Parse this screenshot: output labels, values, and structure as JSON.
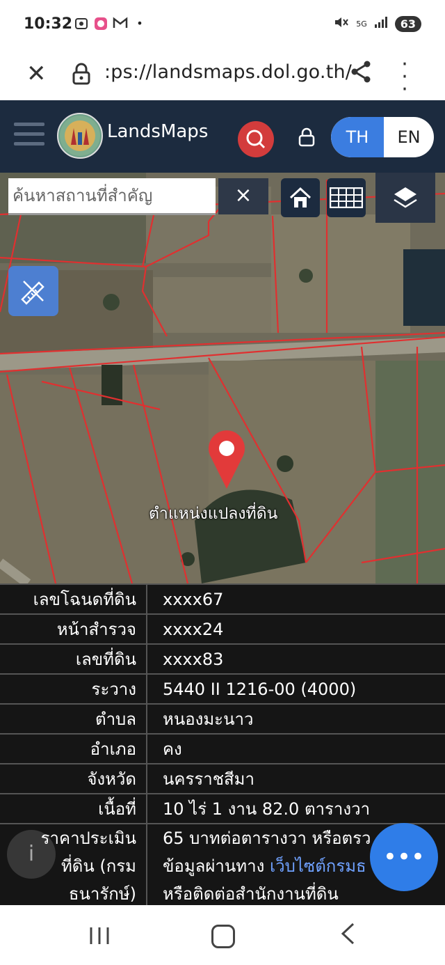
{
  "status_bar": {
    "time": "10:32",
    "network": "5G",
    "battery": "63",
    "icons": [
      "screenshot-icon",
      "app-icon",
      "gmail-icon",
      "dot-icon",
      "mute-icon",
      "signal-icon"
    ]
  },
  "browser": {
    "url": ":ps://landsmaps.dol.go.th/"
  },
  "header": {
    "title": "LandsMaps",
    "lang_th": "TH",
    "lang_en": "EN"
  },
  "map": {
    "search_placeholder": "ค้นหาสถานที่สำคัญ",
    "clear_label": "×",
    "pin_label": "ตำแหน่งแปลงที่ดิน"
  },
  "parcel": {
    "rows": [
      {
        "key": "เลขโฉนดที่ดิน",
        "value": "xxxx67"
      },
      {
        "key": "หน้าสำรวจ",
        "value": "xxxx24"
      },
      {
        "key": "เลขที่ดิน",
        "value": "xxxx83"
      },
      {
        "key": "ระวาง",
        "value": "5440 II 1216-00 (4000)"
      },
      {
        "key": "ตำบล",
        "value": "หนองมะนาว"
      },
      {
        "key": "อำเภอ",
        "value": "คง"
      },
      {
        "key": "จังหวัด",
        "value": "นครราชสีมา"
      },
      {
        "key": "เนื้อที่",
        "value": "10 ไร่ 1 งาน 82.0 ตารางวา"
      }
    ],
    "price": {
      "key_line1": "ราคาประเมิน",
      "key_line2": "ที่ดิน (กรม",
      "key_line3": "ธนารักษ์)",
      "value_line1": "65 บาทต่อตารางวา หรือตรว",
      "value_line2_prefix": "ข้อมูลผ่านทาง ",
      "value_line2_link": "เว็บไซต์กรมธ",
      "value_line3": "หรือติดต่อสำนักงานที่ดิน"
    }
  },
  "fab": {
    "label": "•••"
  },
  "colors": {
    "header_bg": "#1c2b3f",
    "search_red": "#d33c3c",
    "accent_blue": "#3b7de0",
    "parcel_line": "#e03030",
    "table_bg": "#151515",
    "link": "#6fa1ff"
  }
}
